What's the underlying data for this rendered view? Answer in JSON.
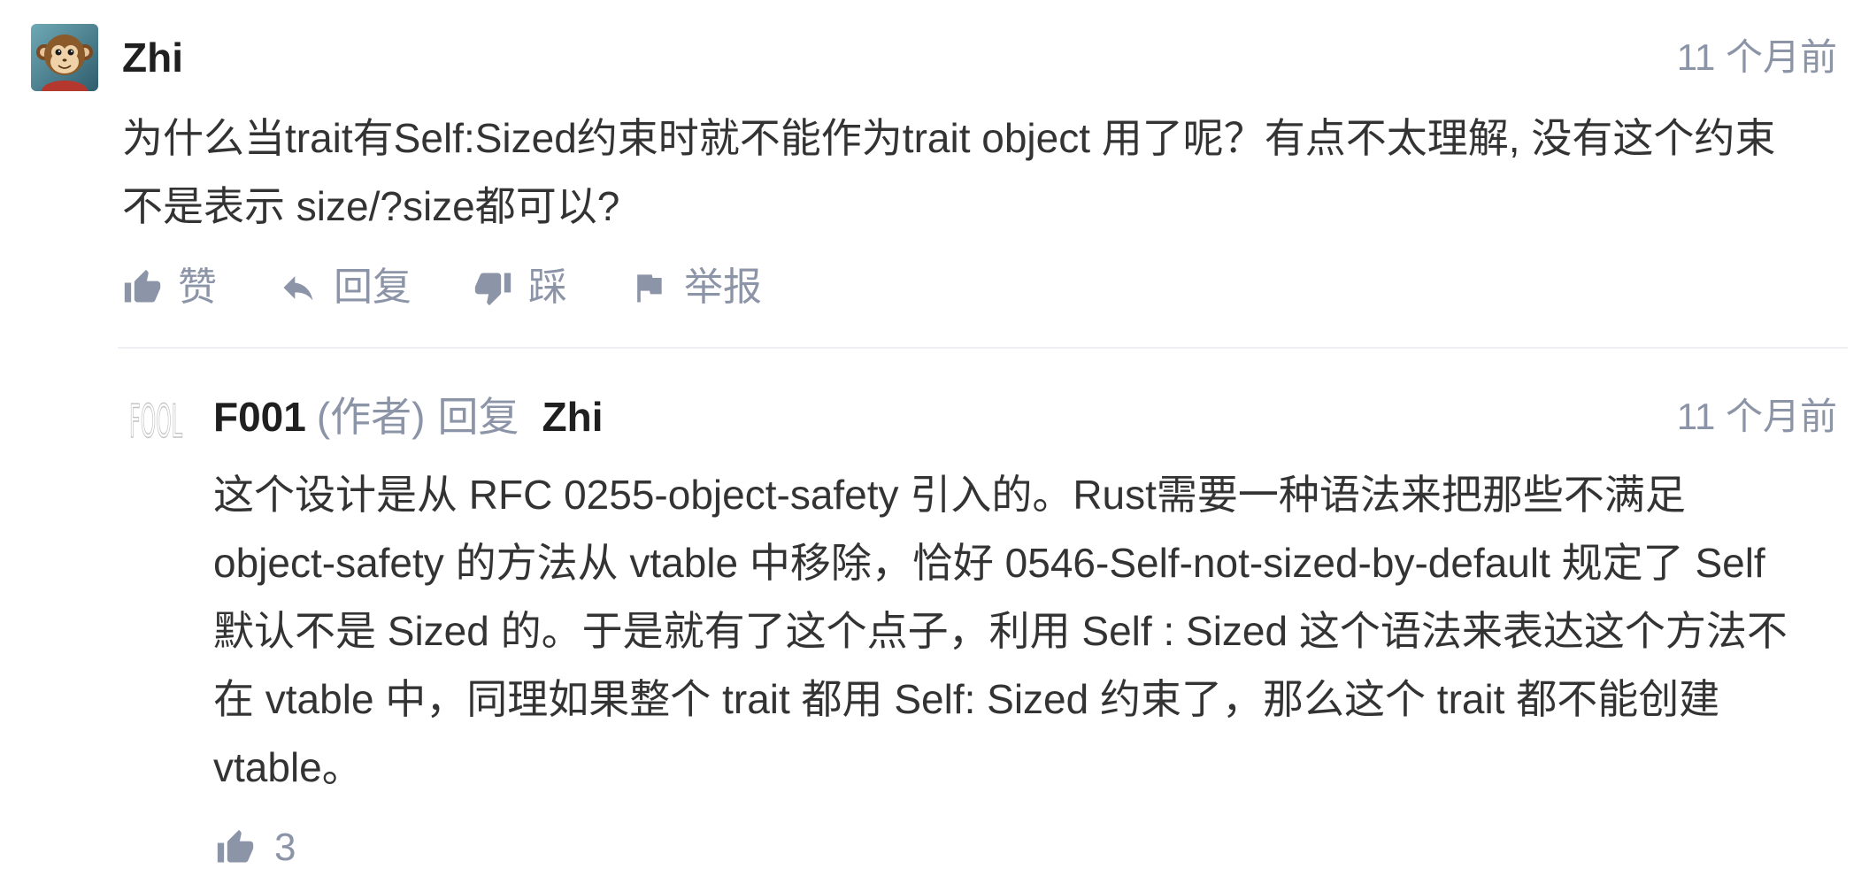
{
  "comment": {
    "author": "Zhi",
    "time": "11 个月前",
    "lines": [
      "为什么当trait有Self:Sized约束时就不能作为trait object 用了呢？有点不太理解, 没有这个约束",
      "不是表示 size/?size都可以?"
    ],
    "actions": {
      "like": "赞",
      "reply": "回复",
      "dislike": "踩",
      "report": "举报"
    }
  },
  "reply": {
    "author_logo_text": "FOOL",
    "author": "F001",
    "author_tag": "(作者)",
    "reply_word": "回复",
    "reply_to": "Zhi",
    "time": "11 个月前",
    "lines": [
      "这个设计是从 RFC 0255-object-safety 引入的。Rust需要一种语法来把那些不满足",
      "object-safety 的方法从 vtable 中移除，恰好 0546-Self-not-sized-by-default 规定了 Self",
      "默认不是 Sized 的。于是就有了这个点子，利用 Self : Sized 这个语法来表达这个方法不",
      "在 vtable 中，同理如果整个 trait 都用 Self: Sized 约束了，那么这个 trait 都不能创建",
      "vtable。"
    ],
    "like_count": "3"
  },
  "icons": {
    "like": "thumbs-up-icon",
    "reply": "reply-arrow-icon",
    "dislike": "thumbs-down-icon",
    "report": "flag-icon",
    "avatar": "monkey-avatar"
  },
  "colors": {
    "meta_gray": "#8c94a7",
    "body_text": "#333333",
    "username": "#1f1f1f",
    "divider": "#eeeff2"
  }
}
